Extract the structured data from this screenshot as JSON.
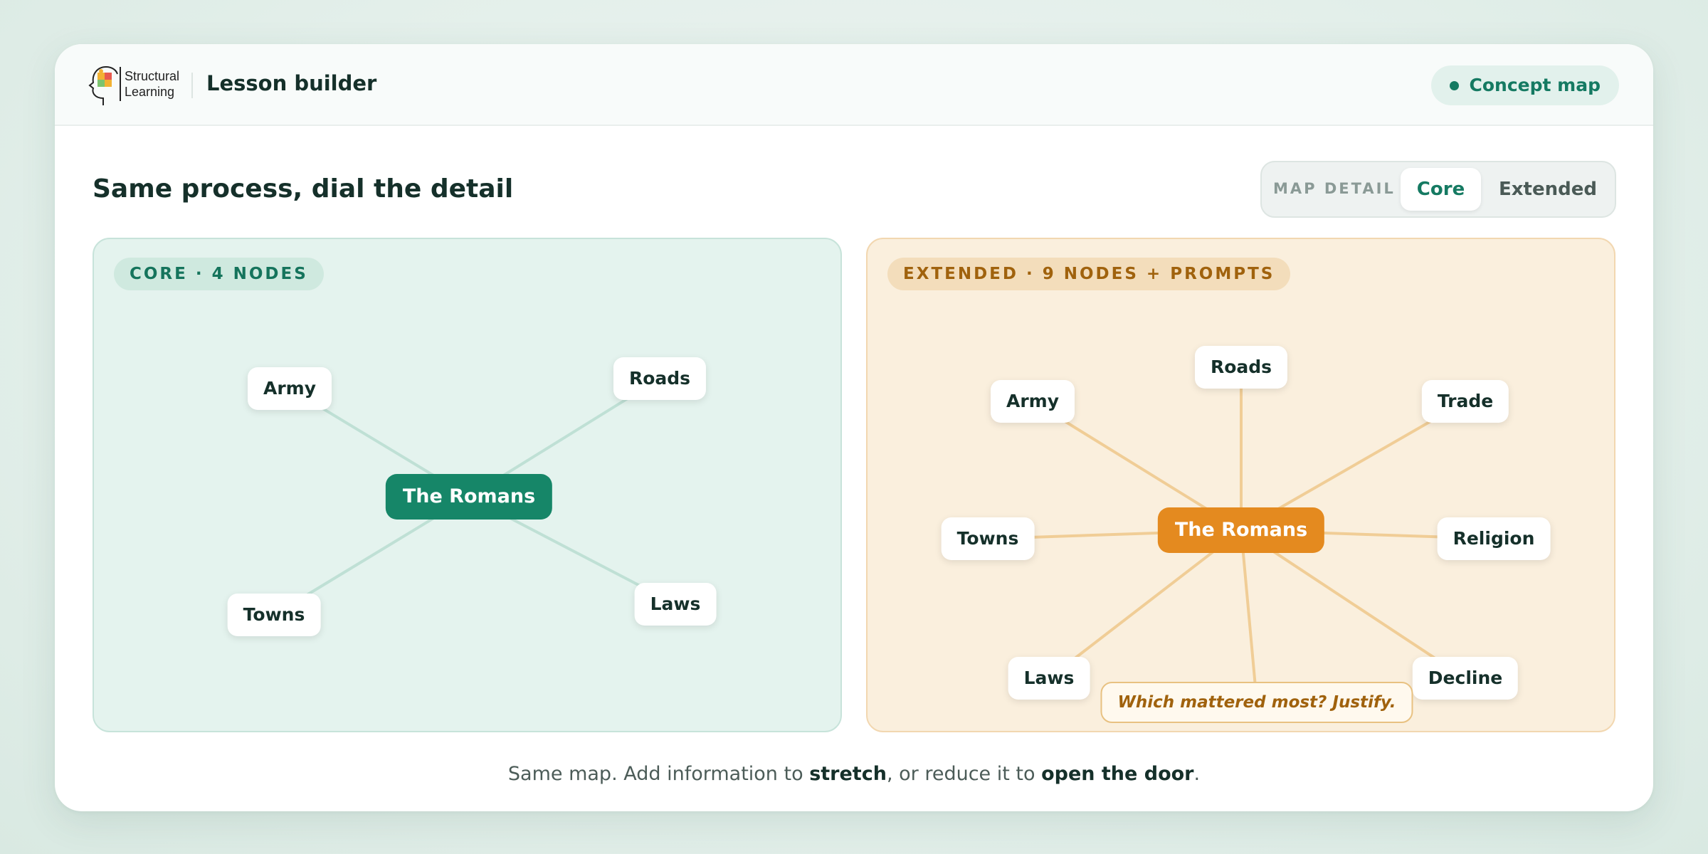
{
  "header": {
    "brand_line1": "Structural",
    "brand_line2": "Learning",
    "app_title": "Lesson builder",
    "mode_label": "Concept map"
  },
  "main": {
    "heading": "Same process, dial the detail",
    "detail_toggle": {
      "label": "MAP DETAIL",
      "options": [
        "Core",
        "Extended"
      ],
      "selected": "Core"
    }
  },
  "core_panel": {
    "tag": "CORE · 4 NODES",
    "center": "The Romans",
    "nodes": [
      "Army",
      "Roads",
      "Towns",
      "Laws"
    ]
  },
  "extended_panel": {
    "tag": "EXTENDED · 9 NODES + PROMPTS",
    "center": "The Romans",
    "nodes": [
      "Army",
      "Roads",
      "Trade",
      "Towns",
      "Religion",
      "Laws",
      "Decline"
    ],
    "prompt": "Which mattered most? Justify."
  },
  "footer": {
    "part1": "Same map. Add information to ",
    "emph1": "stretch",
    "part2": ", or reduce it to ",
    "emph2": "open the door",
    "part3": "."
  },
  "colors": {
    "core_accent": "#168668",
    "extended_accent": "#e48a1f",
    "core_edge": "#bfe0d5",
    "extended_edge": "#f0cd96"
  },
  "icons": {
    "logo": "head-with-puzzle-icon",
    "mode_indicator": "status-dot-icon"
  }
}
